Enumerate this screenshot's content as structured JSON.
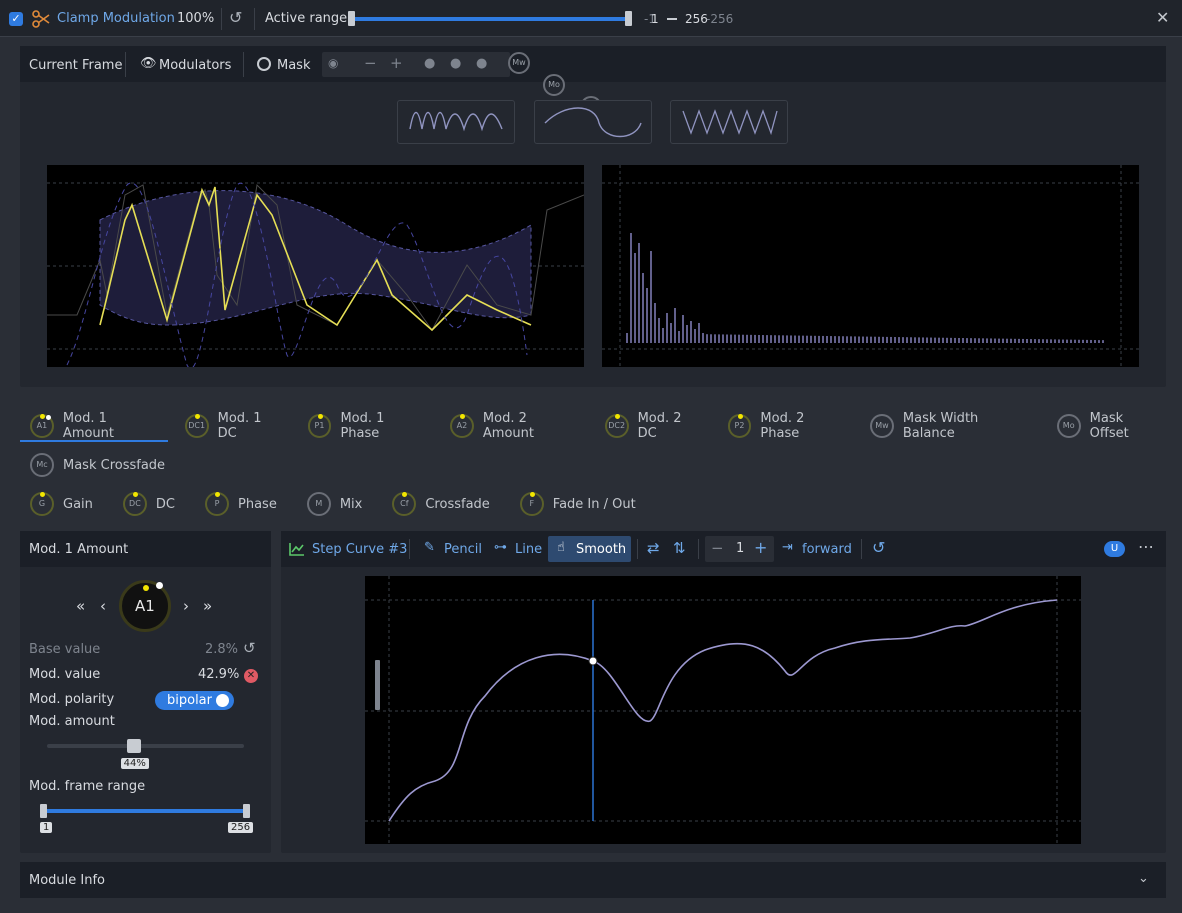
{
  "header": {
    "title": "Clamp Modulation",
    "zoom": "100%",
    "range_label": "Active range",
    "range_start": "1",
    "range_start_alt": "-1",
    "range_end": "256",
    "range_end_alt": "-256"
  },
  "vis": {
    "tab_frame": "Current Frame",
    "tab_mods": "Modulators",
    "tab_mask": "Mask",
    "k1": "Mw",
    "k2": "Mo",
    "k3": "Mc"
  },
  "params": [
    {
      "abbr": "A1",
      "label": "Mod. 1 Amount"
    },
    {
      "abbr": "DC1",
      "label": "Mod. 1 DC"
    },
    {
      "abbr": "P1",
      "label": "Mod. 1 Phase"
    },
    {
      "abbr": "A2",
      "label": "Mod. 2 Amount"
    },
    {
      "abbr": "DC2",
      "label": "Mod. 2 DC"
    },
    {
      "abbr": "P2",
      "label": "Mod. 2 Phase"
    },
    {
      "abbr": "Mw",
      "label": "Mask Width Balance"
    },
    {
      "abbr": "Mo",
      "label": "Mask Offset"
    },
    {
      "abbr": "Mc",
      "label": "Mask Crossfade"
    }
  ],
  "params2": [
    {
      "abbr": "G",
      "label": "Gain"
    },
    {
      "abbr": "DC",
      "label": "DC"
    },
    {
      "abbr": "P",
      "label": "Phase"
    },
    {
      "abbr": "M",
      "label": "Mix"
    },
    {
      "abbr": "Cf",
      "label": "Crossfade"
    },
    {
      "abbr": "F",
      "label": "Fade In / Out"
    }
  ],
  "side": {
    "title": "Mod. 1 Amount",
    "knob": "A1",
    "base_label": "Base value",
    "base_val": "2.8%",
    "mod_label": "Mod. value",
    "mod_val": "42.9%",
    "pol_label": "Mod. polarity",
    "pol_val": "bipolar",
    "amt_label": "Mod. amount",
    "amt_val": "44%",
    "amt_level": 0.44,
    "range_label": "Mod. frame range",
    "range_min": "1",
    "range_max": "256"
  },
  "editor": {
    "curve": "Step Curve #3",
    "pencil": "Pencil",
    "line": "Line",
    "smooth": "Smooth",
    "step": "1",
    "dir": "forward",
    "badge": "U"
  },
  "footer": {
    "label": "Module Info"
  }
}
